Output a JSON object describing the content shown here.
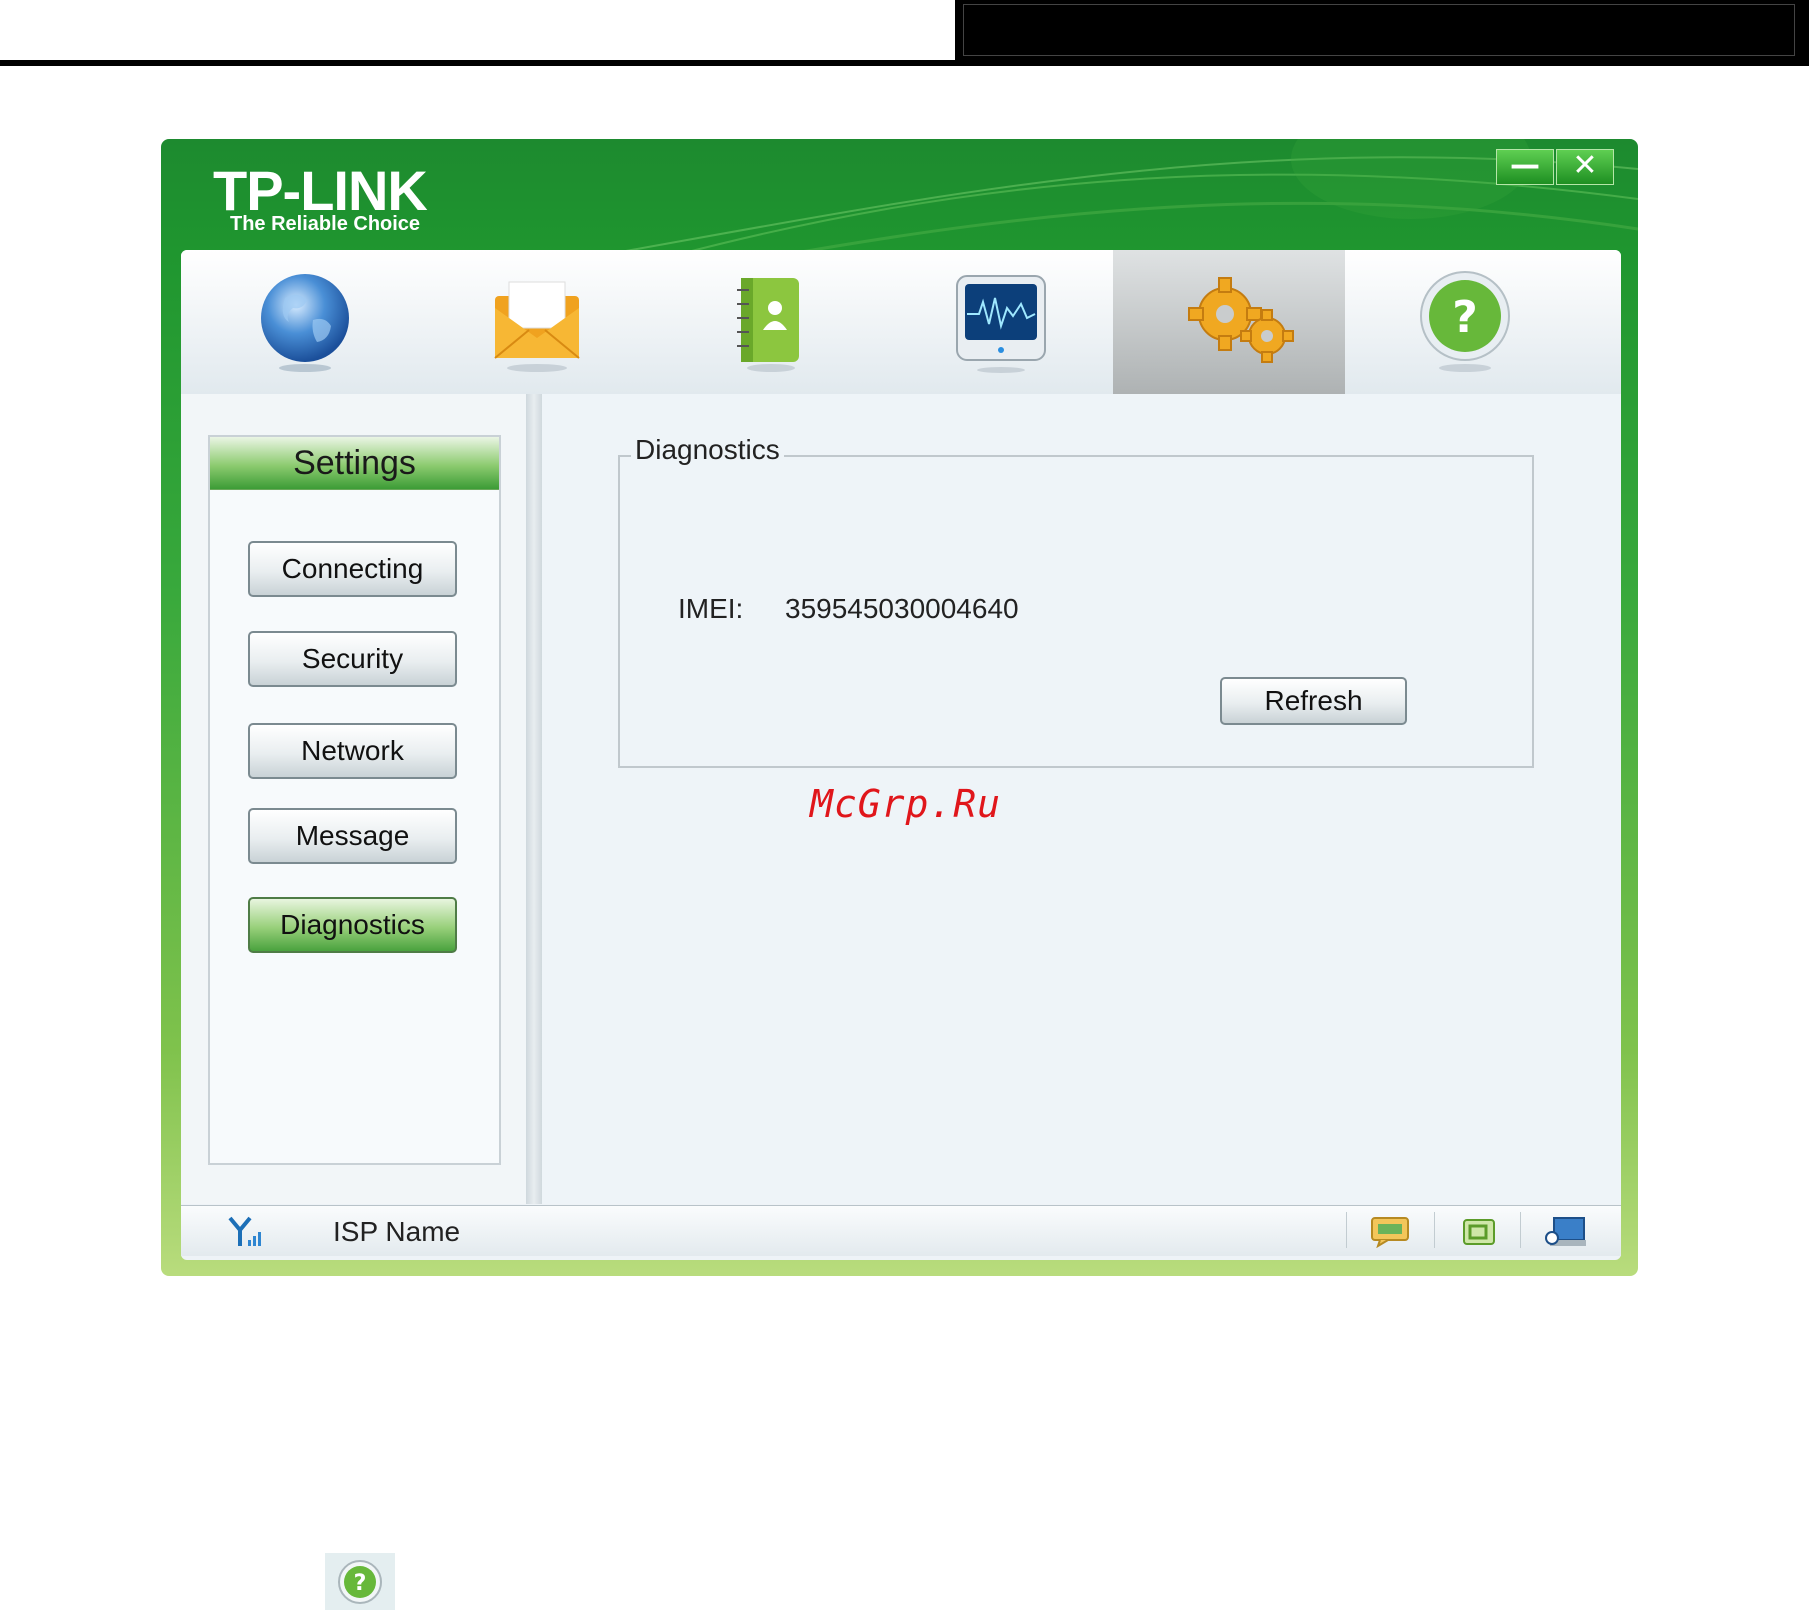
{
  "window": {
    "logo_text": "TP-LINK",
    "tagline": "The Reliable Choice",
    "minimize_label": "—",
    "close_label": "✕"
  },
  "toolbar": {
    "items": [
      {
        "icon": "globe-icon"
      },
      {
        "icon": "envelope-icon"
      },
      {
        "icon": "contacts-book-icon"
      },
      {
        "icon": "monitor-pulse-icon"
      },
      {
        "icon": "gears-icon",
        "active": true
      },
      {
        "icon": "help-circle-icon"
      }
    ]
  },
  "sidebar": {
    "title": "Settings",
    "items": [
      {
        "label": "Connecting"
      },
      {
        "label": "Security"
      },
      {
        "label": "Network"
      },
      {
        "label": "Message"
      },
      {
        "label": "Diagnostics",
        "active": true
      }
    ]
  },
  "diagnostics": {
    "legend": "Diagnostics",
    "imei_label": "IMEI:",
    "imei_value": "359545030004640",
    "refresh_label": "Refresh"
  },
  "watermark": "McGrp.Ru",
  "statusbar": {
    "isp_name": "ISP Name",
    "icons": [
      "signal-icon",
      "chat-icon",
      "sim-card-icon",
      "computer-icon"
    ]
  },
  "colors": {
    "brand_green": "#1f962f",
    "active_green": "#98d07a",
    "watermark_red": "#e0161b"
  }
}
